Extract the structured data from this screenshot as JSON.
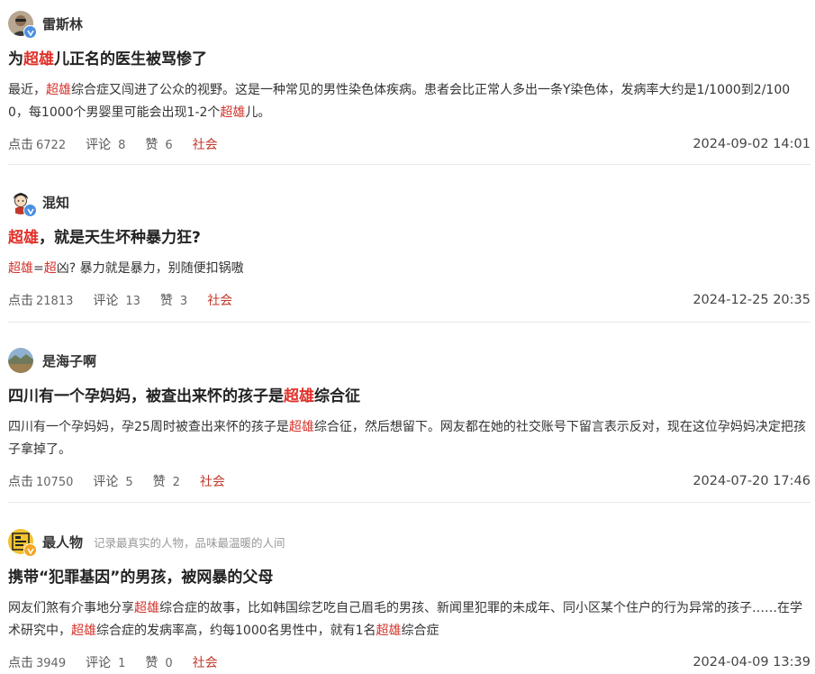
{
  "posts": [
    {
      "author": "雷斯林",
      "title_pre": "为",
      "title_hl": "超雄",
      "title_post": "儿正名的医生被骂惨了",
      "summary_segments": [
        {
          "t": "最近，",
          "hl": false
        },
        {
          "t": "超雄",
          "hl": true
        },
        {
          "t": "综合症又闯进了公众的视野。这是一种常见的男性染色体疾病。患者会比正常人多出一条Y染色体，发病率大约是1/1000到2/1000，每1000个男婴里可能会出现1-2个",
          "hl": false
        },
        {
          "t": "超雄",
          "hl": true
        },
        {
          "t": "儿。",
          "hl": false
        }
      ],
      "clicks_label": "点击",
      "clicks": "6722",
      "comments_label": "评论",
      "comments": "8",
      "likes_label": "赞",
      "likes": "6",
      "category": "社会",
      "date": "2024-09-02 14:01"
    },
    {
      "author": "混知",
      "title_pre": "",
      "title_hl": "超雄",
      "title_post": "，就是天生坏种暴力狂?",
      "summary_segments": [
        {
          "t": "超雄",
          "hl": true
        },
        {
          "t": "=",
          "hl": false
        },
        {
          "t": "超",
          "hl": true
        },
        {
          "t": "凶? 暴力就是暴力，别随便扣锅嗷",
          "hl": false
        }
      ],
      "clicks_label": "点击",
      "clicks": "21813",
      "comments_label": "评论",
      "comments": "13",
      "likes_label": "赞",
      "likes": "3",
      "category": "社会",
      "date": "2024-12-25 20:35"
    },
    {
      "author": "是海子啊",
      "title_pre": "四川有一个孕妈妈，被查出来怀的孩子是",
      "title_hl": "超雄",
      "title_post": "综合征",
      "summary_segments": [
        {
          "t": "四川有一个孕妈妈，孕25周时被查出来怀的孩子是",
          "hl": false
        },
        {
          "t": "超雄",
          "hl": true
        },
        {
          "t": "综合征，然后想留下。网友都在她的社交账号下留言表示反对，现在这位孕妈妈决定把孩子拿掉了。",
          "hl": false
        }
      ],
      "clicks_label": "点击",
      "clicks": "10750",
      "comments_label": "评论",
      "comments": "5",
      "likes_label": "赞",
      "likes": "2",
      "category": "社会",
      "date": "2024-07-20 17:46"
    },
    {
      "author": "最人物",
      "bio": "记录最真实的人物，品味最温暖的人间",
      "title_pre": "携带“犯罪基因”的男孩，被网暴的父母",
      "title_hl": "",
      "title_post": "",
      "summary_segments": [
        {
          "t": "网友们煞有介事地分享",
          "hl": false
        },
        {
          "t": "超雄",
          "hl": true
        },
        {
          "t": "综合症的故事，比如韩国综艺吃自己眉毛的男孩、新闻里犯罪的未成年、同小区某个住户的行为异常的孩子……在学术研究中，",
          "hl": false
        },
        {
          "t": "超雄",
          "hl": true
        },
        {
          "t": "综合症的发病率高，约每1000名男性中，就有1名",
          "hl": false
        },
        {
          "t": "超雄",
          "hl": true
        },
        {
          "t": "综合症",
          "hl": false
        }
      ],
      "clicks_label": "点击",
      "clicks": "3949",
      "comments_label": "评论",
      "comments": "1",
      "likes_label": "赞",
      "likes": "0",
      "category": "社会",
      "date": "2024-04-09 13:39"
    }
  ],
  "colors": {
    "highlight": "#d4322a",
    "category": "#c0392b",
    "verified_badge": "#4a90e2"
  },
  "icons": [
    "avatar-photo-man",
    "avatar-cartoon-boy",
    "avatar-landscape",
    "avatar-logo-zuirenwu",
    "verified-v-icon"
  ]
}
